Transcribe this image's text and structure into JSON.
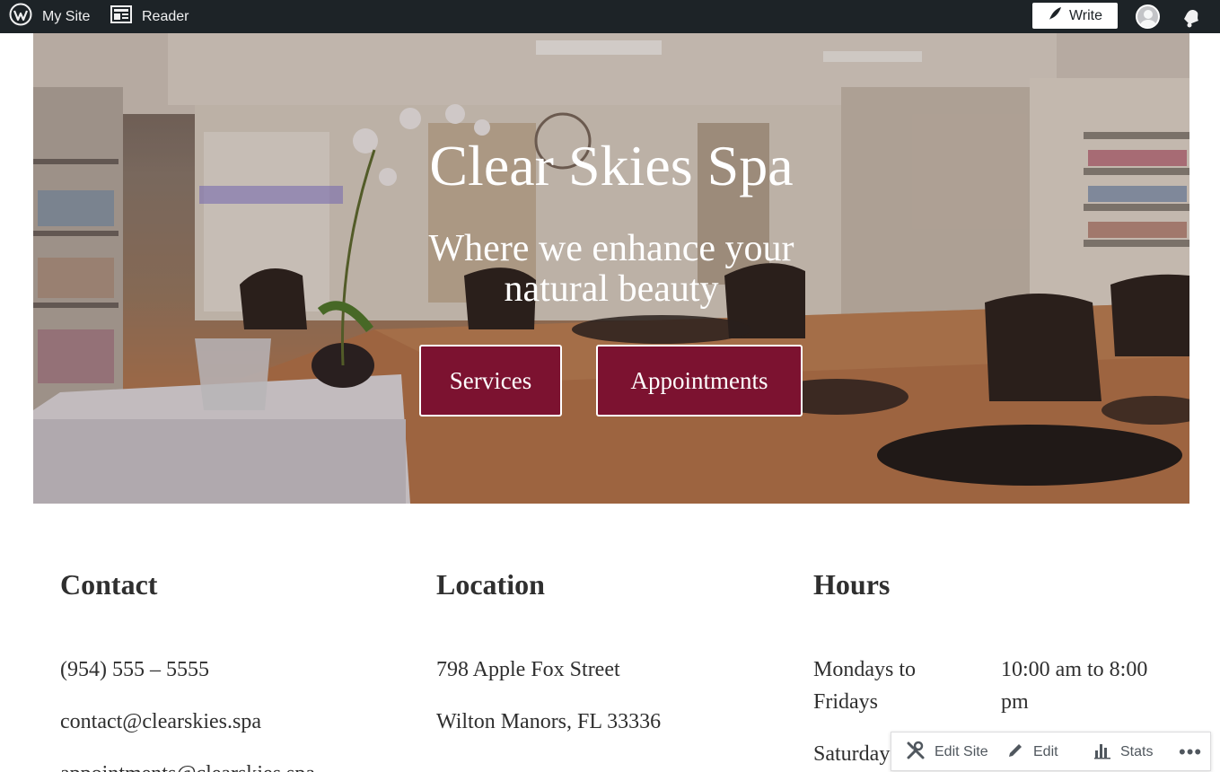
{
  "admin_bar": {
    "my_site": "My Site",
    "reader": "Reader",
    "write": "Write"
  },
  "hero": {
    "title": "Clear Skies Spa",
    "subtitle": "Where we enhance your natural beauty",
    "buttons": [
      "Services",
      "Appointments"
    ]
  },
  "contact": {
    "heading": "Contact",
    "phone": "(954) 555 – 5555",
    "email": "contact@clearskies.spa",
    "email2": "appointments@clearskies.spa"
  },
  "location": {
    "heading": "Location",
    "street": "798 Apple Fox Street",
    "city": "Wilton Manors, FL 33336"
  },
  "hours": {
    "heading": "Hours",
    "rows": [
      {
        "days": "Mondays to Fridays",
        "time": "10:00 am to 8:00 pm"
      },
      {
        "days": "Saturdays",
        "time": ""
      }
    ]
  },
  "floating_bar": {
    "edit_site": "Edit Site",
    "edit": "Edit",
    "stats": "Stats",
    "more": "•••"
  },
  "colors": {
    "admin_bar_bg": "#1d2327",
    "button_bg": "#7c1230",
    "text": "#2f2f2f"
  }
}
